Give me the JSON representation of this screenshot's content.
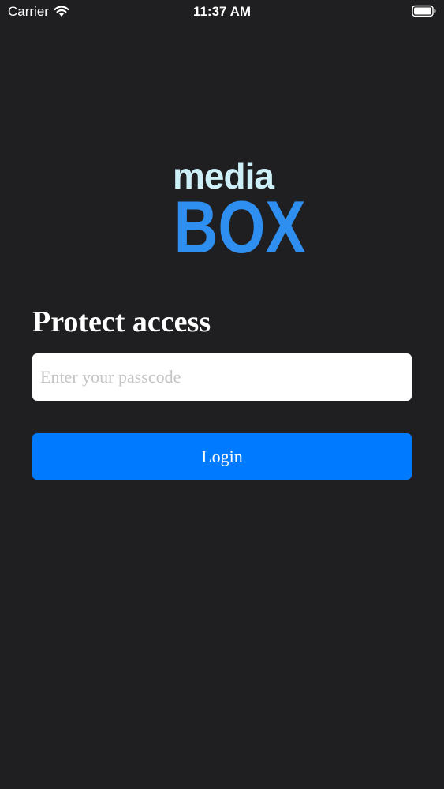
{
  "status_bar": {
    "carrier": "Carrier",
    "time": "11:37 AM",
    "wifi_icon": "wifi-icon",
    "battery_icon": "battery-icon"
  },
  "logo": {
    "line1": "media",
    "line2": "BOX",
    "colors": {
      "media": "#cdeff7",
      "box": "#2f8ff0"
    }
  },
  "page": {
    "title": "Protect access"
  },
  "passcode": {
    "value": "",
    "placeholder": "Enter your passcode"
  },
  "login_button": {
    "label": "Login",
    "color": "#007aff"
  },
  "theme": {
    "background": "#1f1f21"
  }
}
